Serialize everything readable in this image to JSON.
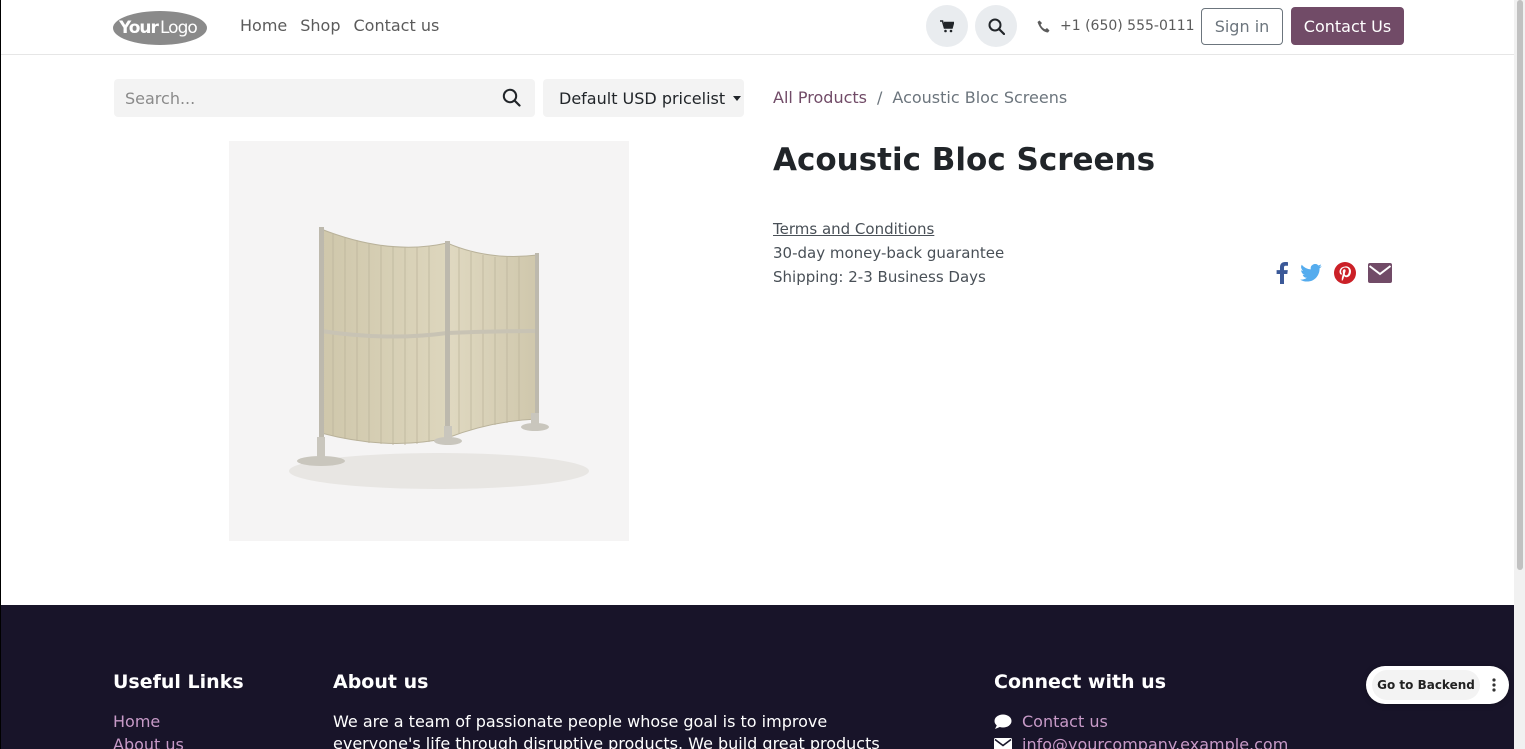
{
  "header": {
    "logo_text": "YourLogo",
    "nav": [
      "Home",
      "Shop",
      "Contact us"
    ],
    "phone": "+1 (650) 555-0111",
    "sign_in": "Sign in",
    "contact_us": "Contact Us"
  },
  "search": {
    "placeholder": "Search..."
  },
  "pricelist": "Default USD pricelist",
  "breadcrumb": {
    "parent": "All Products",
    "separator": "/",
    "current": "Acoustic Bloc Screens"
  },
  "product": {
    "title": "Acoustic Bloc Screens",
    "terms": "Terms and Conditions",
    "guarantee": "30-day money-back guarantee",
    "shipping": "Shipping: 2-3 Business Days"
  },
  "share_icons": [
    "facebook-icon",
    "twitter-icon",
    "pinterest-icon",
    "email-icon"
  ],
  "colors": {
    "primary": "#714b67",
    "facebook": "#3b5998",
    "twitter": "#55acee",
    "pinterest": "#cb2027",
    "footer_bg": "#181429"
  },
  "footer": {
    "useful_links_title": "Useful Links",
    "useful_links": [
      "Home",
      "About us"
    ],
    "about_title": "About us",
    "about_line1": "We are a team of passionate people whose goal is to improve",
    "about_line2": "everyone's life through disruptive products. We build great products to",
    "connect_title": "Connect with us",
    "connect_contact": "Contact us",
    "connect_email": "info@yourcompany.example.com"
  },
  "backend_button": "Go to Backend"
}
